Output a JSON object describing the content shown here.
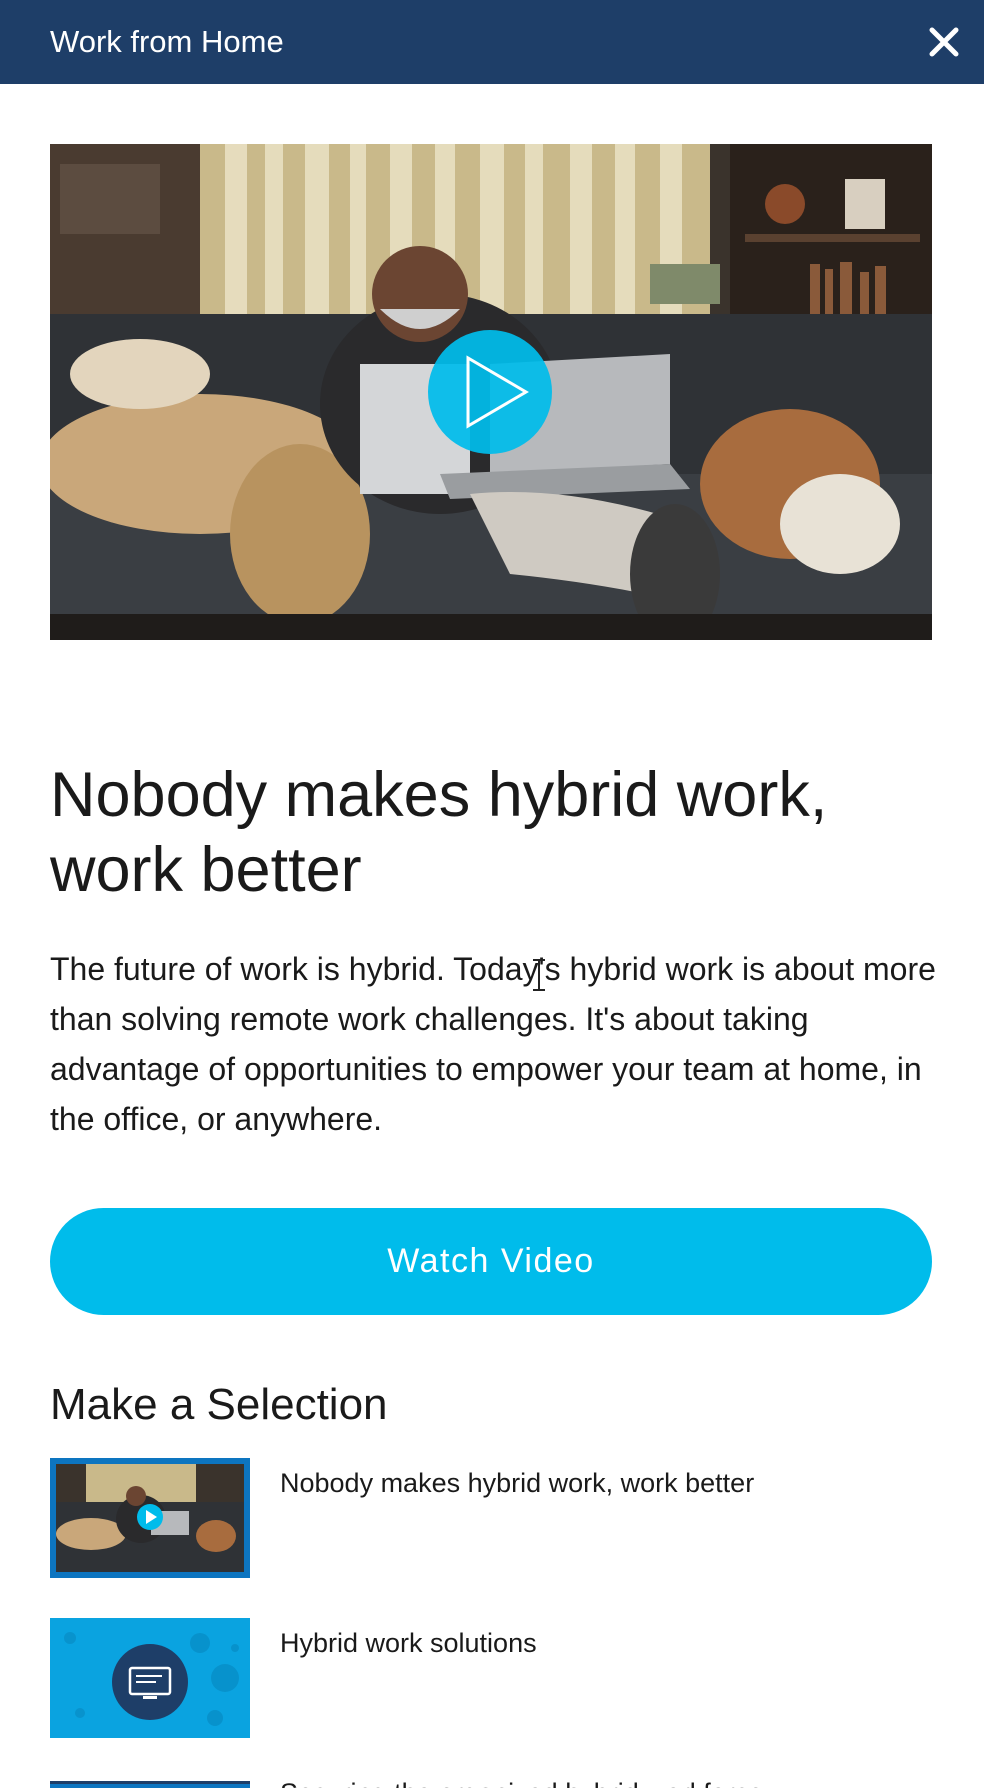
{
  "header": {
    "title": "Work from Home",
    "close_icon": "close-icon"
  },
  "hero": {
    "play_icon": "play-icon",
    "colors": {
      "play": "#00bceb"
    }
  },
  "main": {
    "headline": "Nobody makes hybrid work, work better",
    "description": "The future of work is hybrid. Today's hybrid work is about more than solving remote work challenges. It's about taking advantage of opportunities to empower your team at home, in the office, or anywhere.",
    "cta_label": "Watch Video"
  },
  "selection": {
    "title": "Make a Selection",
    "items": [
      {
        "label": "Nobody makes hybrid work, work better",
        "active": true
      },
      {
        "label": "Hybrid work solutions",
        "active": false
      },
      {
        "label": "Securing the organized hybrid workforce",
        "active": false
      }
    ]
  },
  "colors": {
    "header_bg": "#1e3e68",
    "accent": "#00bceb",
    "active_border": "#0d75c0"
  }
}
